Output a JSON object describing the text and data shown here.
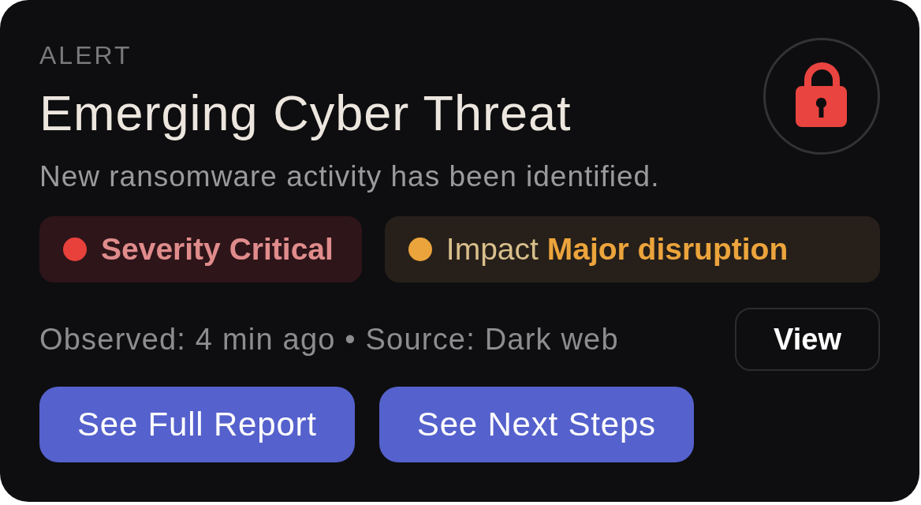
{
  "header": {
    "eyebrow": "ALERT",
    "title": "Emerging Cyber Threat",
    "subtitle": "New ransomware activity has been identified."
  },
  "tags": [
    {
      "kind": "danger",
      "label": "Severity",
      "value": "Critical",
      "color": "#e8413c"
    },
    {
      "kind": "warning",
      "label": "Impact",
      "value": "Major disruption",
      "color": "#eba33b"
    }
  ],
  "meta": "Observed: 4 min ago • Source: Dark web",
  "view_button": "View",
  "actions": [
    "See Full Report",
    "See Next Steps"
  ]
}
